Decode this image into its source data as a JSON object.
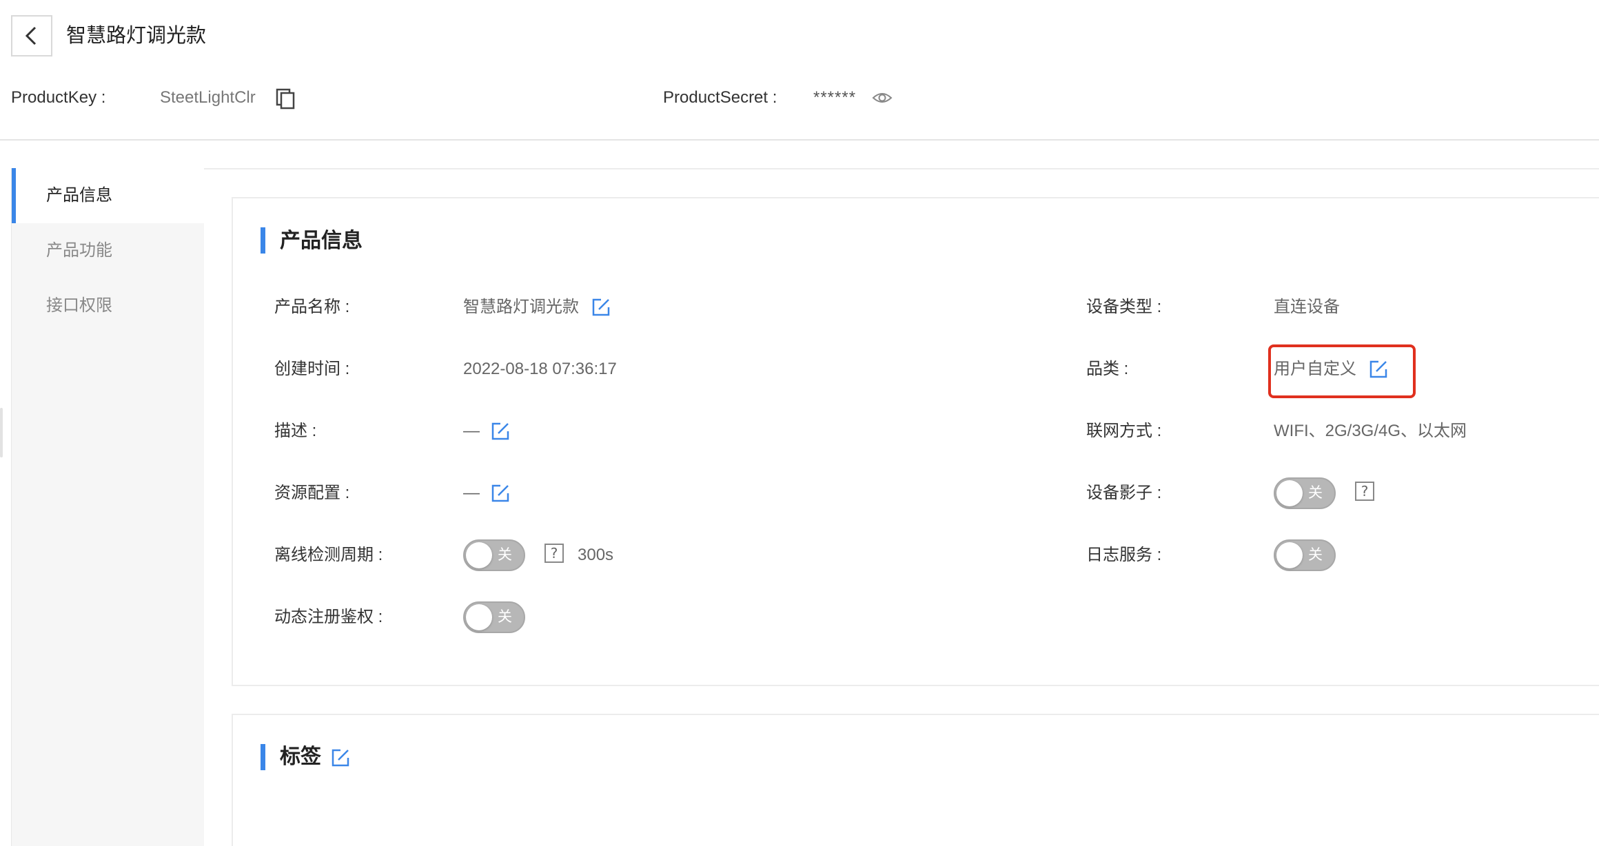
{
  "header": {
    "title": "智慧路灯调光款",
    "product_key_label": "ProductKey :",
    "product_key_value": "SteetLightClr",
    "product_secret_label": "ProductSecret :",
    "product_secret_value": "******"
  },
  "sidebar": {
    "items": [
      {
        "label": "产品信息",
        "active": true
      },
      {
        "label": "产品功能",
        "active": false
      },
      {
        "label": "接口权限",
        "active": false
      }
    ]
  },
  "info_section": {
    "title": "产品信息",
    "product_name_label": "产品名称 :",
    "product_name_value": "智慧路灯调光款",
    "created_label": "创建时间 :",
    "created_value": "2022-08-18 07:36:17",
    "description_label": "描述 :",
    "description_value": "—",
    "resource_label": "资源配置 :",
    "resource_value": "—",
    "offline_label": "离线检测周期 :",
    "offline_toggle": "关",
    "offline_period": "300s",
    "dynamic_label": "动态注册鉴权 :",
    "dynamic_toggle": "关",
    "device_type_label": "设备类型 :",
    "device_type_value": "直连设备",
    "category_label": "品类 :",
    "category_value": "用户自定义",
    "network_label": "联网方式 :",
    "network_value": "WIFI、2G/3G/4G、以太网",
    "shadow_label": "设备影子 :",
    "shadow_toggle": "关",
    "log_label": "日志服务 :",
    "log_toggle": "关",
    "help_symbol": "?"
  },
  "tags_section": {
    "title": "标签"
  },
  "colors": {
    "accent": "#3a86e8",
    "highlight": "#e0301e",
    "toggle_off": "#b7b7b7"
  },
  "icons": [
    "back-arrow-icon",
    "copy-icon",
    "eye-icon",
    "edit-icon",
    "help-icon"
  ]
}
